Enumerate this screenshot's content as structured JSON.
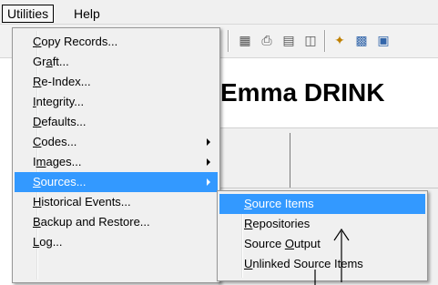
{
  "menubar": {
    "items": [
      {
        "label": "Utilities",
        "active": true
      },
      {
        "label": "Help",
        "active": false
      }
    ]
  },
  "toolbar": {
    "icons": [
      "grid-icon",
      "printer-icon",
      "properties-icon",
      "preview-icon",
      "sparkle-tool-icon",
      "records-icon",
      "form-icon"
    ]
  },
  "background": {
    "record_title": "Emma DRINK"
  },
  "utilities_menu": {
    "items": [
      {
        "pre": "",
        "ul": "C",
        "post": "opy Records...",
        "submenu": false,
        "selected": false
      },
      {
        "pre": "Gr",
        "ul": "a",
        "post": "ft...",
        "submenu": false,
        "selected": false
      },
      {
        "pre": "",
        "ul": "R",
        "post": "e-Index...",
        "submenu": false,
        "selected": false
      },
      {
        "pre": "",
        "ul": "I",
        "post": "ntegrity...",
        "submenu": false,
        "selected": false
      },
      {
        "pre": "",
        "ul": "D",
        "post": "efaults...",
        "submenu": false,
        "selected": false
      },
      {
        "pre": "",
        "ul": "C",
        "post": "odes...",
        "submenu": true,
        "selected": false
      },
      {
        "pre": "I",
        "ul": "m",
        "post": "ages...",
        "submenu": true,
        "selected": false
      },
      {
        "pre": "",
        "ul": "S",
        "post": "ources...",
        "submenu": true,
        "selected": true
      },
      {
        "pre": "",
        "ul": "H",
        "post": "istorical Events...",
        "submenu": false,
        "selected": false
      },
      {
        "pre": "",
        "ul": "B",
        "post": "ackup and Restore...",
        "submenu": false,
        "selected": false
      },
      {
        "pre": "",
        "ul": "L",
        "post": "og...",
        "submenu": false,
        "selected": false
      }
    ]
  },
  "sources_submenu": {
    "items": [
      {
        "pre": "",
        "ul": "S",
        "post": "ource Items",
        "selected": true
      },
      {
        "pre": "",
        "ul": "R",
        "post": "epositories",
        "selected": false
      },
      {
        "pre": "Source ",
        "ul": "O",
        "post": "utput",
        "selected": false
      },
      {
        "pre": "",
        "ul": "U",
        "post": "nlinked Source Items",
        "selected": false
      }
    ]
  },
  "colors": {
    "menu_background": "#f0f0f0",
    "highlight": "#3399ff",
    "highlight_text": "#ffffff",
    "menu_border": "#979797"
  }
}
